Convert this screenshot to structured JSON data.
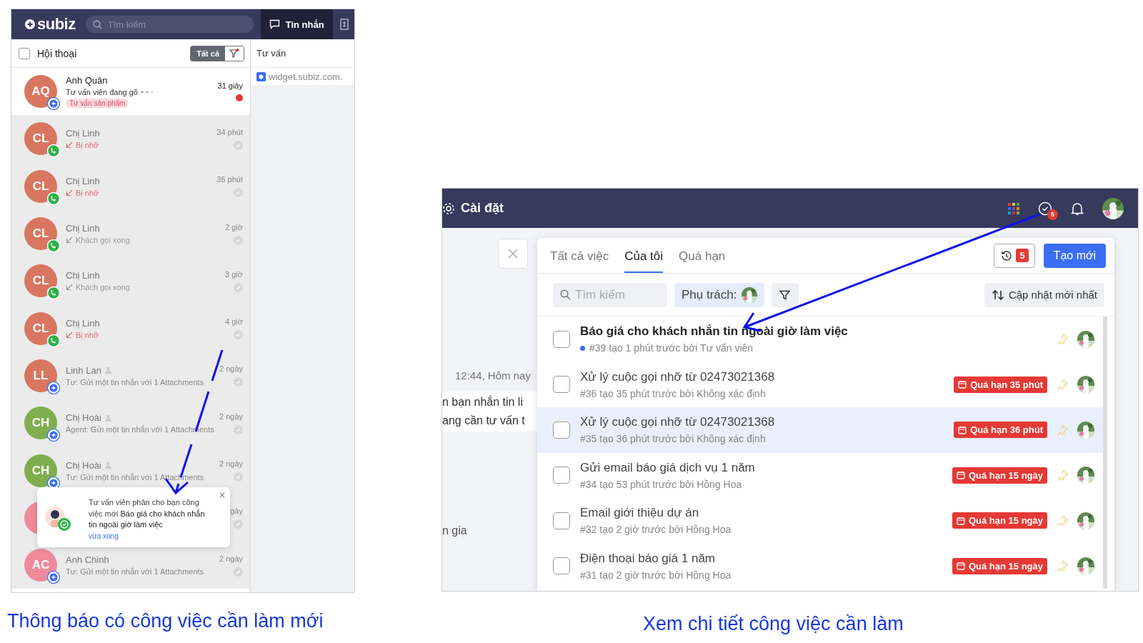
{
  "inbox": {
    "logo": "subiz",
    "search_placeholder": "Tìm kiếm",
    "tab": "Tin nhắn",
    "toolbar": {
      "title": "Hội thoại",
      "checked": false,
      "filter": "Tất cả"
    },
    "conversations": [
      {
        "initials": "AQ",
        "color": "#d9765f",
        "kind": "chat",
        "name": "Anh Quân",
        "agent": false,
        "time": "31 giây",
        "typing": true,
        "preview": "Tư vấn viên đang gõ",
        "tag": "Tư vấn sản phẩm",
        "unread": true,
        "selected": true
      },
      {
        "initials": "CL",
        "color": "#d9765f",
        "kind": "call",
        "name": "Chị Linh",
        "agent": false,
        "time": "34 phút",
        "typing": false,
        "missed": true,
        "preview": "Bị nhỡ",
        "unread": false,
        "selected": false
      },
      {
        "initials": "CL",
        "color": "#d9765f",
        "kind": "call",
        "name": "Chị Linh",
        "agent": false,
        "time": "35 phút",
        "typing": false,
        "missed": true,
        "preview": "Bị nhỡ",
        "unread": false,
        "selected": false
      },
      {
        "initials": "CL",
        "color": "#d9765f",
        "kind": "call",
        "name": "Chị Linh",
        "agent": false,
        "time": "2 giờ",
        "typing": false,
        "missed": false,
        "preview": "Khách gọi xong",
        "unread": false,
        "selected": false
      },
      {
        "initials": "CL",
        "color": "#d9765f",
        "kind": "call",
        "name": "Chị Linh",
        "agent": false,
        "time": "3 giờ",
        "typing": false,
        "missed": false,
        "preview": "Khách gọi xong",
        "unread": false,
        "selected": false
      },
      {
        "initials": "CL",
        "color": "#d9765f",
        "kind": "call",
        "name": "Chị Linh",
        "agent": false,
        "time": "4 giờ",
        "typing": false,
        "missed": true,
        "preview": "Bị nhỡ",
        "unread": false,
        "selected": false
      },
      {
        "initials": "LL",
        "color": "#d9765f",
        "kind": "chat",
        "name": "Linh Lan",
        "agent": true,
        "time": "2 ngày",
        "typing": false,
        "preview": "Tư: Gửi một tin nhắn với 1 Attachments",
        "unread": false,
        "selected": false
      },
      {
        "initials": "CH",
        "color": "#7fae4f",
        "kind": "chat",
        "name": "Chị Hoài",
        "agent": true,
        "time": "2 ngày",
        "typing": false,
        "preview": "Agent: Gửi một tin nhắn với 1 Attachments",
        "unread": false,
        "selected": false
      },
      {
        "initials": "CH",
        "color": "#7fae4f",
        "kind": "chat",
        "name": "Chị Hoài",
        "agent": true,
        "time": "2 ngày",
        "typing": false,
        "preview": "Tư: Gửi một tin nhắn với 1 Attachments",
        "unread": false,
        "selected": false
      },
      {
        "color": "#f08a9a",
        "agent": false,
        "time": "gày",
        "unread": false,
        "selected": false
      },
      {
        "initials": "AC",
        "color": "#f08a9a",
        "kind": "chat",
        "name": "Anh Chinh",
        "agent": false,
        "time": "2 ngày",
        "typing": false,
        "preview": "Tư: Gửi một tin nhắn với 1 Attachments",
        "unread": false,
        "selected": false
      }
    ],
    "side": {
      "title": "Tư vấn",
      "link": "widget.subiz.com."
    },
    "toast": {
      "text": "Tư vấn viên phân cho bạn công việc mới **Báo giá cho khách nhắn tin ngoài giờ làm việc**",
      "time": "vừa xong"
    }
  },
  "workspace": {
    "settings": "Cài đặt",
    "task_count": "5",
    "background_texts": [
      "12:44, Hôm nay",
      "n bạn nhắn tin li",
      "ang cần tư vấn t",
      "n gia"
    ],
    "tasks": {
      "tabs": [
        {
          "label": "Tất cả việc",
          "selected": false
        },
        {
          "label": "Của tôi",
          "selected": true
        },
        {
          "label": "Quá hạn",
          "selected": false
        }
      ],
      "history_count": "5",
      "create": "Tạo mới",
      "search_placeholder": "Tìm kiếm",
      "assignee": "Phụ trách:",
      "sort": "Cập nhật mới nhất",
      "items": [
        {
          "title": "Báo giá cho khách nhắn tin ngoài giờ làm việc",
          "meta": "#39 tạo 1 phút trước bởi Tư vấn viên",
          "unread": true,
          "selected": false
        },
        {
          "title": "Xử lý cuộc gọi nhỡ từ 02473021368",
          "meta": "#36 tạo 35 phút trước bởi Không xác định",
          "overdue": "Quá hạn 35 phút",
          "unread": false,
          "selected": false
        },
        {
          "title": "Xử lý cuộc gọi nhỡ từ 02473021368",
          "meta": "#35 tạo 36 phút trước bởi Không xác định",
          "overdue": "Quá hạn 36 phút",
          "unread": false,
          "selected": true
        },
        {
          "title": "Gửi email báo giá dịch vụ 1 năm",
          "meta": "#34 tạo 53 phút trước bởi Hồng Hoa",
          "overdue": "Quá hạn 15 ngày",
          "unread": false,
          "selected": false
        },
        {
          "title": "Email giới thiệu dự án",
          "meta": "#32 tạo 2 giờ trước bởi Hồng Hoa",
          "overdue": "Quá hạn 15 ngày",
          "unread": false,
          "selected": false
        },
        {
          "title": "Điện thoại báo giá 1 năm",
          "meta": "#31 tạo 2 giờ trước bởi Hồng Hoa",
          "overdue": "Quá hạn 15 ngày",
          "unread": false,
          "selected": false
        }
      ]
    }
  },
  "captions": [
    "Thông báo có công việc cần làm mới",
    "Xem chi tiết công việc cần làm"
  ]
}
